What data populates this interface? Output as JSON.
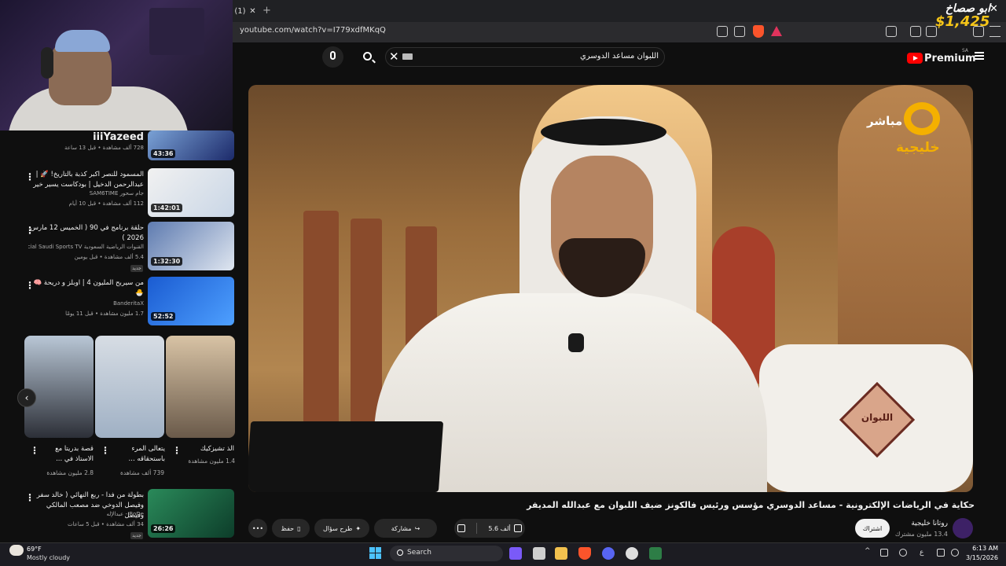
{
  "browser": {
    "tab_label": "(1)",
    "tab_close": "✕",
    "new_tab": "+",
    "url": "youtube.com/watch?v=I779xdfMKqQ"
  },
  "donation": {
    "name": "ابو صصاخ",
    "amount": "$1,425",
    "close": "✕"
  },
  "youtube": {
    "brand": "Premium",
    "region": "SA",
    "search_query": "اللبوان مساعد الدوسري",
    "search_clear": "✕"
  },
  "player": {
    "channel_logo_mubasher": "مباشر",
    "channel_logo_khalijiya": "خليجية",
    "show_emblem": "اللبوان"
  },
  "video": {
    "title": "حكاية في الرياضات الإلكترونية - مساعد الدوسري مؤسس ورئيس فالكونز ضيف اللبوان مع عبدالله المديفر",
    "channel_name": "روتانا خليجية",
    "subscribers": "13.4 مليون مشترك",
    "subscribe_label": "اشتراك",
    "likes": "5.6 ألف",
    "share_label": "مشاركة",
    "ask_label": "طرح سؤال",
    "save_label": "حفظ",
    "more_label": "•••"
  },
  "sidebar": {
    "recommendations": [
      {
        "title": "iiiYazeed",
        "channel": "",
        "meta": "728 ألف مشاهدة • قبل 13 ساعة",
        "duration": "43:36"
      },
      {
        "title": "المسمود للنصر اكبر كذبة بالتاريخ! 🚀 | عبدالرحمن الدخيل | بودكاست يسير خير",
        "channel": "جام سحور SAM6TIME",
        "meta": "112 ألف مشاهدة • قبل 10 أيام",
        "duration": "1:42:01"
      },
      {
        "title": "حلقة برنامج في 90 ( الخميس 12 مارس 2026 )",
        "channel": "القنوات الرياضية السعودية Official Saudi Sports TV",
        "meta": "5.4 ألف مشاهدة • قبل يومين",
        "duration": "1:32:30",
        "badge": "جديد"
      },
      {
        "title": "من سيربح المليون 4 | اوبلز و دريحة 🧠🐣",
        "channel": "BanderitaX",
        "meta": "1.7 مليون مشاهدة • قبل 11 يومًا",
        "duration": "52:52"
      },
      {
        "title": "بطولة من فدا - ربع النهائي ( خالد سفر وفيصل الدوخي ضد مصعب المالكي وفيصل",
        "channel": "BoDe - عبدالإله",
        "meta": "34 ألف مشاهدة • قبل 5 ساعات",
        "duration": "26:26",
        "badge": "جديد"
      }
    ],
    "shorts": [
      {
        "title": "الذ تشيزكيك",
        "views": "1.4 مليون مشاهدة"
      },
      {
        "title": "يتعالى المرء باستحقاقه ...",
        "views": "739 ألف مشاهدة"
      },
      {
        "title": "قصة بدريتا مع الاستاذ في ...",
        "views": "2.8 مليون مشاهدة"
      }
    ],
    "shorts_prev": "‹"
  },
  "taskbar": {
    "weather_temp": "69°F",
    "weather_desc": "Mostly cloudy",
    "search_placeholder": "Search",
    "time": "6:13 AM",
    "date": "3/15/2026",
    "lang": "ع"
  }
}
